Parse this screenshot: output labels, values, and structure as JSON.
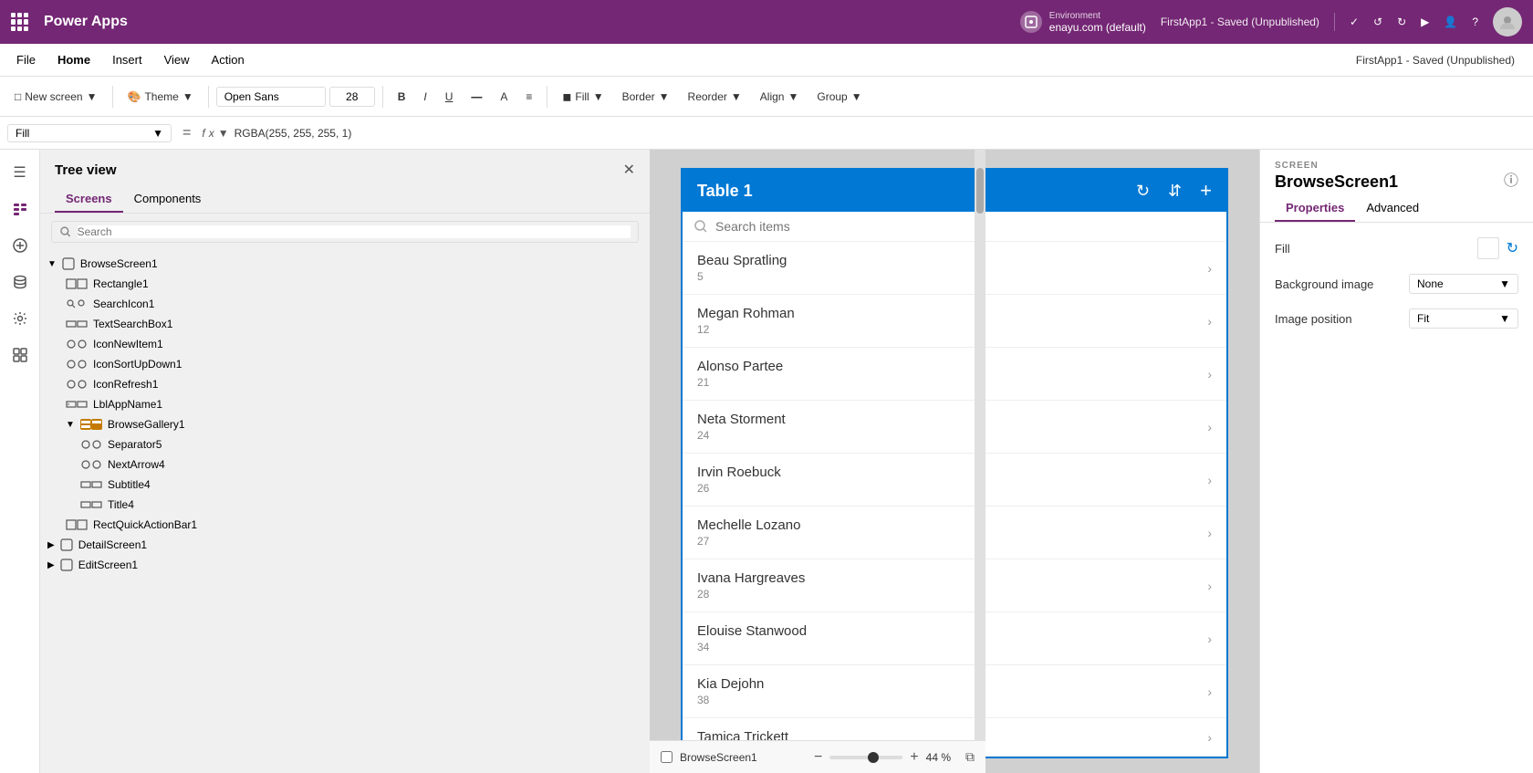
{
  "app": {
    "title": "Power Apps",
    "save_status": "FirstApp1 - Saved (Unpublished)",
    "environment": "enayu.com (default)"
  },
  "menubar": {
    "items": [
      "File",
      "Home",
      "Insert",
      "View",
      "Action"
    ],
    "active": "Home"
  },
  "toolbar": {
    "new_screen_label": "New screen",
    "theme_label": "Theme",
    "font_name": "Open Sans",
    "font_size": "28",
    "fill_label": "Fill",
    "border_label": "Border",
    "reorder_label": "Reorder",
    "align_label": "Align",
    "group_label": "Group"
  },
  "formulabar": {
    "property": "Fill",
    "formula": "RGBA(255, 255, 255, 1)"
  },
  "left_panel": {
    "title": "Tree view",
    "tabs": [
      "Screens",
      "Components"
    ],
    "active_tab": "Screens",
    "search_placeholder": "Search",
    "items": [
      {
        "name": "Rectangle1",
        "indent": 1,
        "type": "rect"
      },
      {
        "name": "SearchIcon1",
        "indent": 1,
        "type": "icon"
      },
      {
        "name": "TextSearchBox1",
        "indent": 1,
        "type": "text"
      },
      {
        "name": "IconNewItem1",
        "indent": 1,
        "type": "icon"
      },
      {
        "name": "IconSortUpDown1",
        "indent": 1,
        "type": "icon"
      },
      {
        "name": "IconRefresh1",
        "indent": 1,
        "type": "icon"
      },
      {
        "name": "LblAppName1",
        "indent": 1,
        "type": "label"
      },
      {
        "name": "BrowseGallery1",
        "indent": 1,
        "type": "gallery",
        "expanded": true
      },
      {
        "name": "Separator5",
        "indent": 2,
        "type": "separator"
      },
      {
        "name": "NextArrow4",
        "indent": 2,
        "type": "icon"
      },
      {
        "name": "Subtitle4",
        "indent": 2,
        "type": "label"
      },
      {
        "name": "Title4",
        "indent": 2,
        "type": "label"
      },
      {
        "name": "RectQuickActionBar1",
        "indent": 1,
        "type": "rect"
      },
      {
        "name": "DetailScreen1",
        "indent": 0,
        "type": "screen",
        "collapsed": true
      },
      {
        "name": "EditScreen1",
        "indent": 0,
        "type": "screen",
        "collapsed": true
      }
    ]
  },
  "canvas": {
    "screen_name": "BrowseScreen1",
    "table_title": "Table 1",
    "search_placeholder": "Search items",
    "list_items": [
      {
        "name": "Beau Spratling",
        "num": "5"
      },
      {
        "name": "Megan Rohman",
        "num": "12"
      },
      {
        "name": "Alonso Partee",
        "num": "21"
      },
      {
        "name": "Neta Storment",
        "num": "24"
      },
      {
        "name": "Irvin Roebuck",
        "num": "26"
      },
      {
        "name": "Mechelle Lozano",
        "num": "27"
      },
      {
        "name": "Ivana Hargreaves",
        "num": "28"
      },
      {
        "name": "Elouise Stanwood",
        "num": "34"
      },
      {
        "name": "Kia Dejohn",
        "num": "38"
      },
      {
        "name": "Tamica Trickett",
        "num": ""
      }
    ]
  },
  "right_panel": {
    "section_label": "SCREEN",
    "title": "BrowseScreen1",
    "tabs": [
      "Properties",
      "Advanced"
    ],
    "active_tab": "Properties",
    "props": {
      "fill_label": "Fill",
      "background_image_label": "Background image",
      "background_image_value": "None",
      "image_position_label": "Image position",
      "image_position_value": "Fit"
    }
  },
  "bottom_bar": {
    "screen_name": "BrowseScreen1",
    "zoom_minus": "−",
    "zoom_plus": "+",
    "zoom_level": "44 %"
  }
}
